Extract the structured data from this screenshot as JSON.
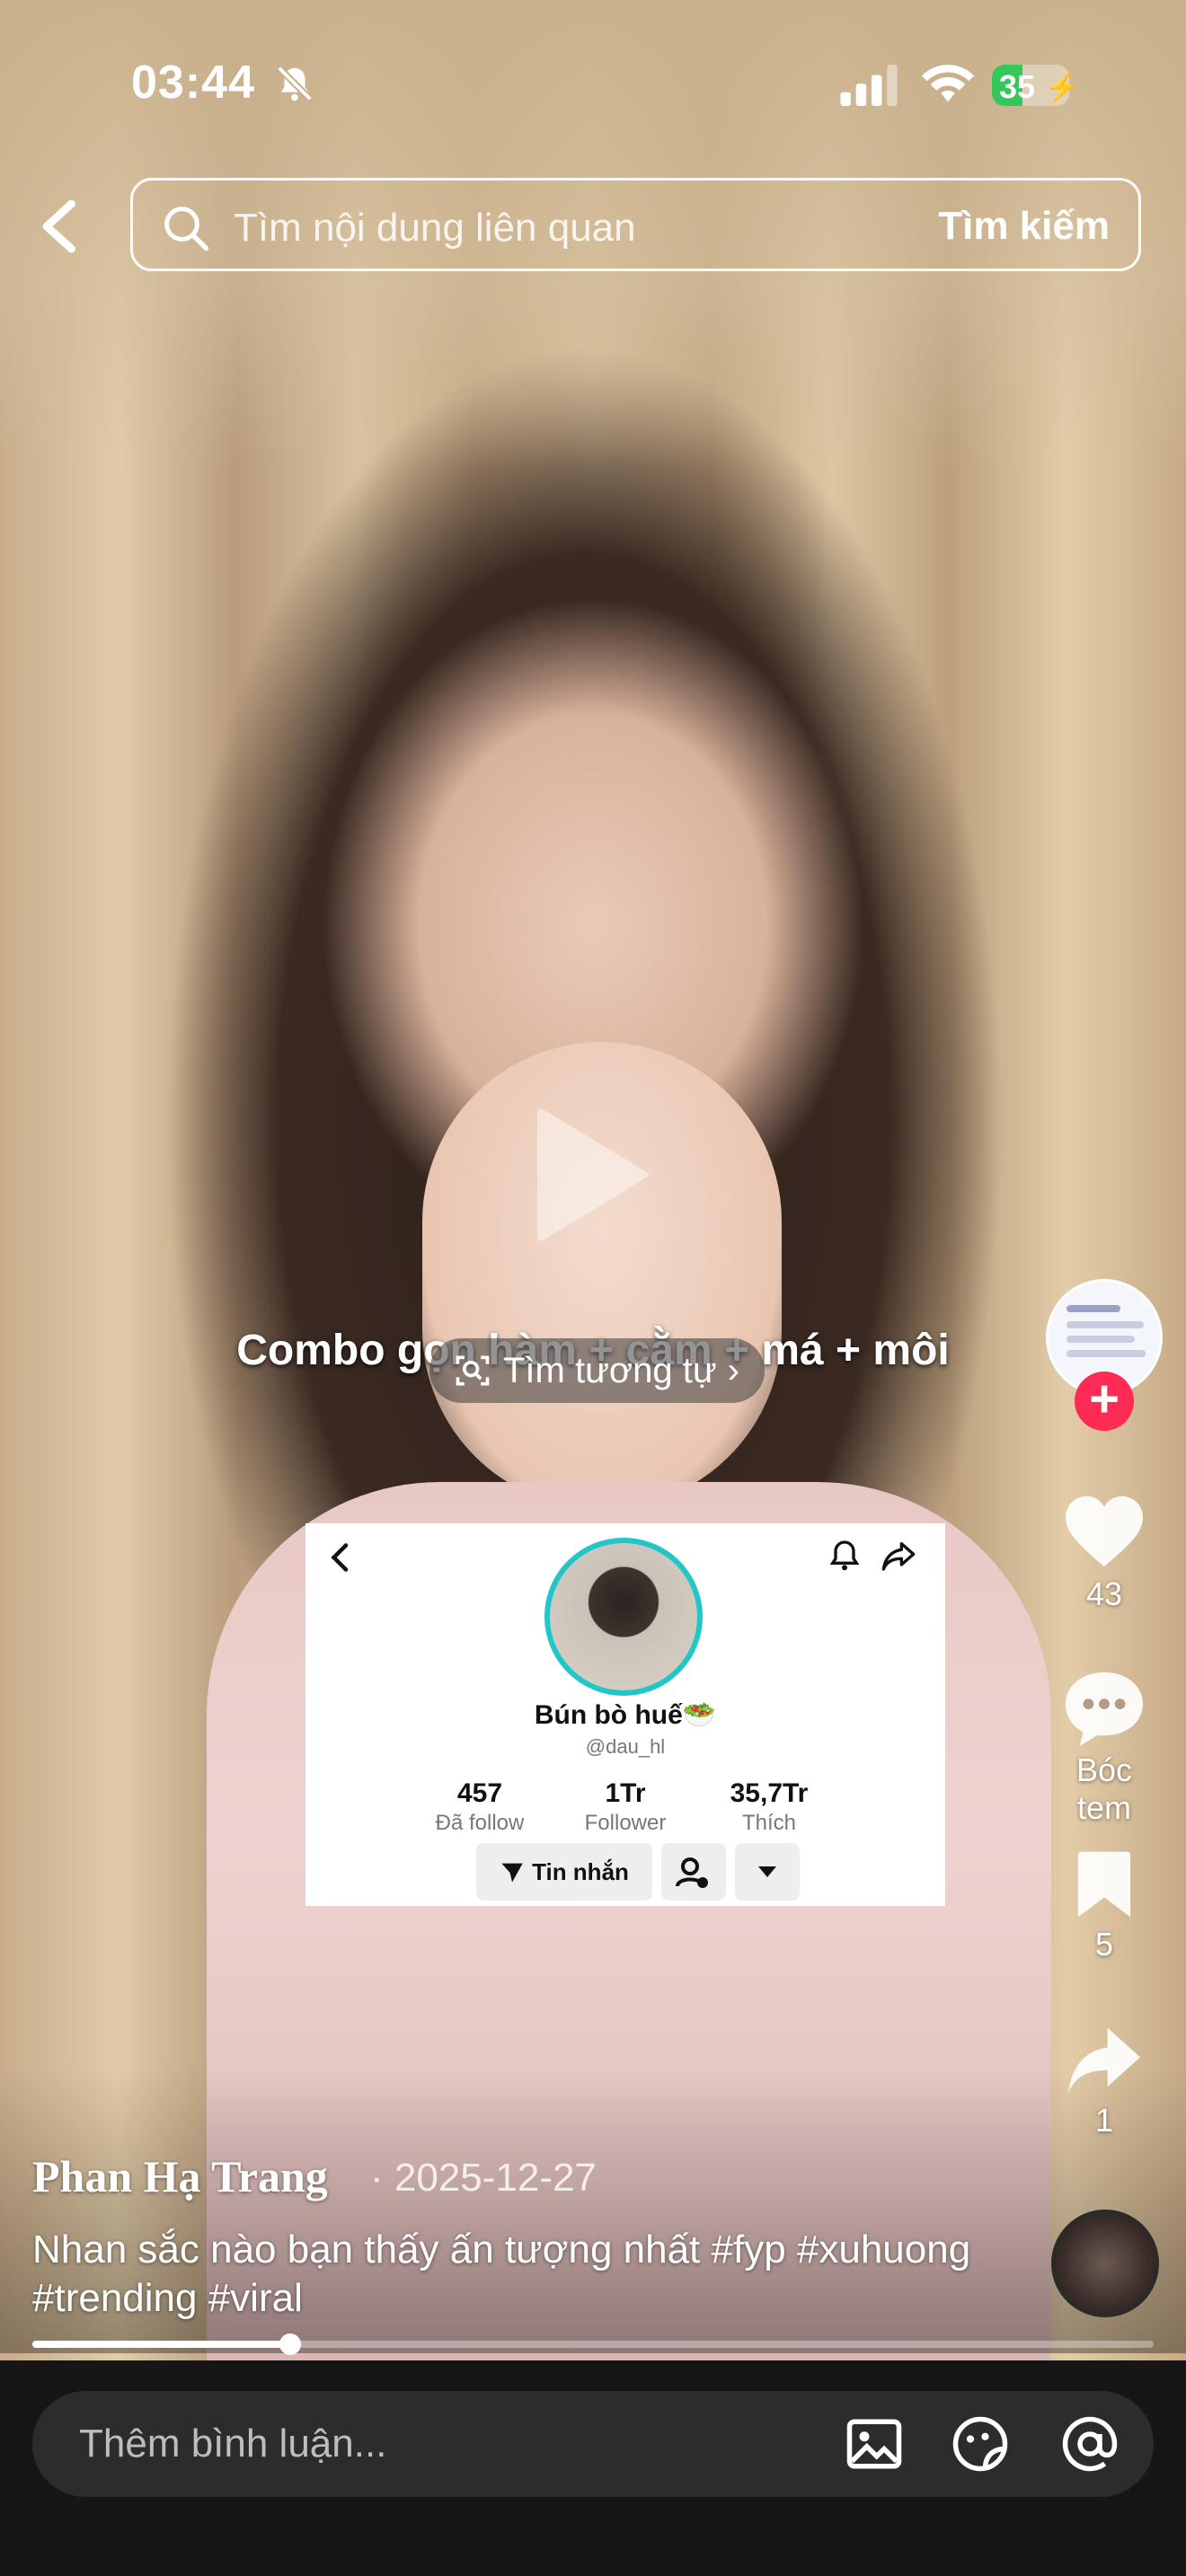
{
  "status_bar": {
    "time": "03:44",
    "battery": "35",
    "battery_color": "#34c759"
  },
  "search": {
    "placeholder": "Tìm nội dung liên quan",
    "button": "Tìm kiếm"
  },
  "video": {
    "caption": "Combo gọn hàm + cằm + má + môi",
    "similar_label": "Tìm tương tự",
    "embedded_profile": {
      "name": "Bún bò huế🥗",
      "handle": "@dau_hl",
      "stats": [
        {
          "value": "457",
          "label": "Đã follow"
        },
        {
          "value": "1Tr",
          "label": "Follower"
        },
        {
          "value": "35,7Tr",
          "label": "Thích"
        }
      ],
      "message_button": "Tin nhắn"
    }
  },
  "rail": {
    "avatar_name": "Phan Hạ Trang",
    "likes": "43",
    "comments": "Bóc tem",
    "saves": "5",
    "shares": "1"
  },
  "post": {
    "author": "Phan Hạ Trang",
    "date": "· 2025-12-27",
    "description": "Nhan sắc nào bạn thấy ấn tượng nhất #fyp #xuhuong #trending #viral",
    "progress": 0.23
  },
  "comment_bar": {
    "placeholder": "Thêm bình luận..."
  },
  "colors": {
    "accent": "#fe2c55",
    "ring": "#20c6c8"
  }
}
